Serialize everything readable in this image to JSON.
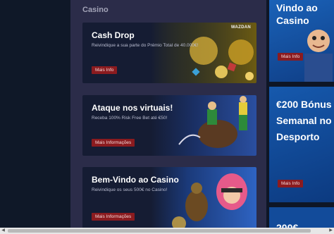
{
  "section": {
    "title": "Casino"
  },
  "cards": [
    {
      "title": "Cash Drop",
      "subtitle": "Reivindique a sua parte do Prémio Total de 40.000€!",
      "button": "Mais Info",
      "logo": "WAZDAN"
    },
    {
      "title": "Ataque nos virtuais!",
      "subtitle": "Receba 100% Risk Free Bet até €50!",
      "button": "Mais Informações"
    },
    {
      "title": "Bem-Vindo ao Casino",
      "subtitle": "Reivindique os seus 500€ no Casino!",
      "button": "Mais Informações"
    }
  ],
  "promos": [
    {
      "title": "Vindo ao Casino",
      "button": "Mais Info"
    },
    {
      "title": "€200 Bónus Semanal no Desporto",
      "button": "Mais Info"
    },
    {
      "title": "200€"
    }
  ],
  "colors": {
    "accent_button": "#8b1b1f",
    "panel": "#2b2c49",
    "background": "#0e1626",
    "promo_blue": "#1659ad"
  }
}
